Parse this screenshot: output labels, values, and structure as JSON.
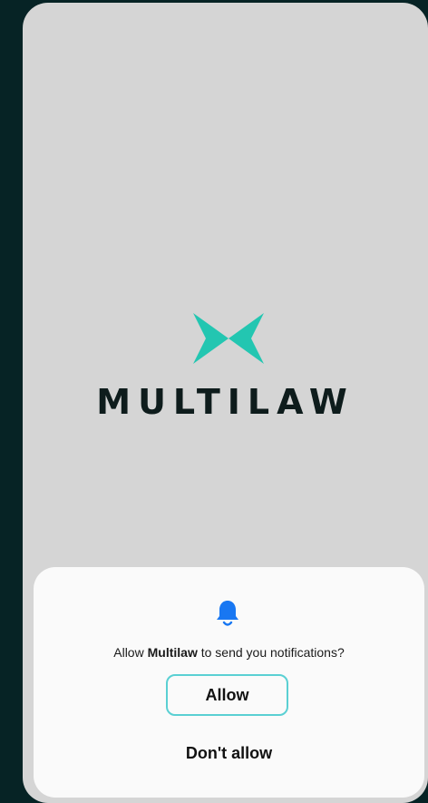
{
  "app": {
    "brand_name": "MULTILAW",
    "brand_color": "#23c6b1"
  },
  "notification_prompt": {
    "icon": "bell-icon",
    "message_prefix": "Allow ",
    "app_name": "Multilaw",
    "message_suffix": " to send you notifications?",
    "allow_label": "Allow",
    "deny_label": "Don't allow",
    "accent_color": "#5ad0d3",
    "icon_color": "#1877f2"
  }
}
